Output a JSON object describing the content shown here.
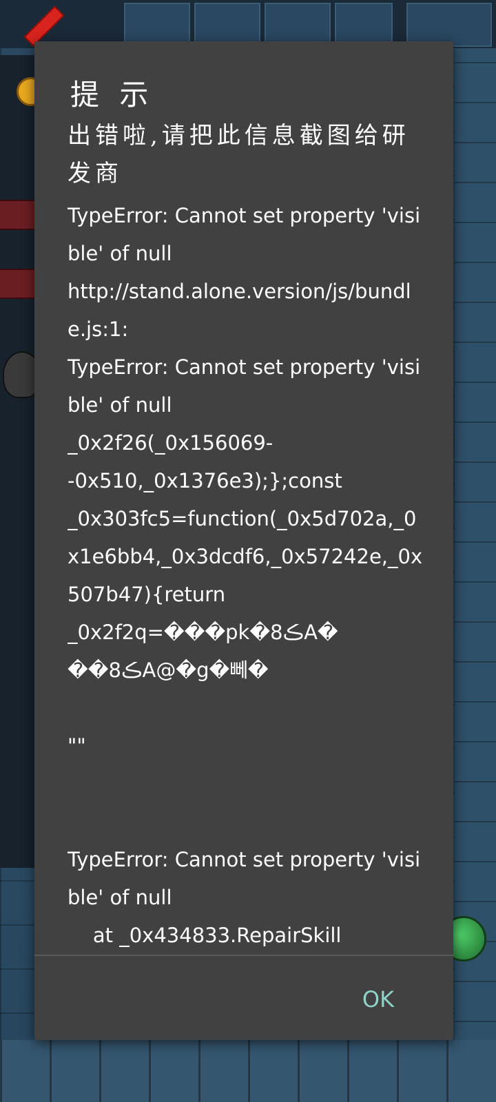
{
  "dialog": {
    "title": "提 示",
    "message": "出错啦,请把此信息截图给研发商",
    "log": "TypeError: Cannot set property 'visible' of null\nhttp://stand.alone.version/js/bundle.js:1:\nTypeError: Cannot set property 'visible' of null\n_0x2f26(_0x156069-\n-0x510,_0x1376e3);};const\n_0x303fc5=function(_0x5d702a,_0x1e6bb4,_0x3dcdf6,_0x57242e,_0x507b47){return\n_0x2f2q=���pk�8ڪA�\n��8ڪA@�g�뻬�\n\n\"\"\n\n\nTypeError: Cannot set property 'visible' of null\n    at _0x434833.RepairSkill",
    "ok_label": "OK"
  }
}
